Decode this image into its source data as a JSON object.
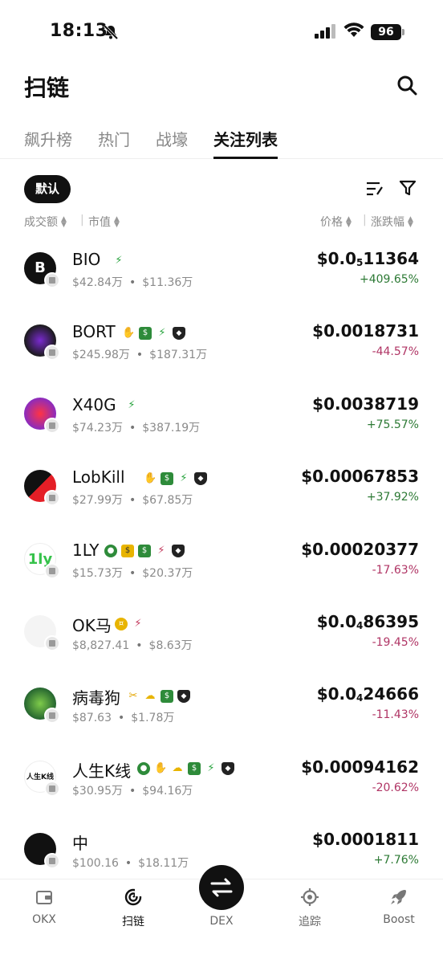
{
  "status": {
    "time": "18:13",
    "battery": "96"
  },
  "header": {
    "title": "扫链"
  },
  "tabs": [
    {
      "label": "飙升榜"
    },
    {
      "label": "热门"
    },
    {
      "label": "战壕"
    },
    {
      "label": "关注列表"
    }
  ],
  "filter": {
    "chip": "默认"
  },
  "columns": {
    "volume": "成交额",
    "mcap": "市值",
    "price": "价格",
    "change": "涨跌幅"
  },
  "tokens": [
    {
      "name": "BIO",
      "tags": [
        "bolt"
      ],
      "volume": "$42.84万",
      "mcap": "$11.36万",
      "price_prefix": "$0.0",
      "price_sub": "5",
      "price_rest": "11364",
      "change": "+409.65%",
      "dir": "up"
    },
    {
      "name": "BORT",
      "tags": [
        "hand",
        "bag",
        "bolt",
        "ghost"
      ],
      "volume": "$245.98万",
      "mcap": "$187.31万",
      "price_prefix": "$0.0018731",
      "price_sub": "",
      "price_rest": "",
      "change": "-44.57%",
      "dir": "down"
    },
    {
      "name": "X40G",
      "tags": [
        "bolt"
      ],
      "volume": "$74.23万",
      "mcap": "$387.19万",
      "price_prefix": "$0.0038719",
      "price_sub": "",
      "price_rest": "",
      "change": "+75.57%",
      "dir": "up"
    },
    {
      "name": "LobKill",
      "tags": [
        "hand",
        "bag",
        "bolt",
        "ghost"
      ],
      "volume": "$27.99万",
      "mcap": "$67.85万",
      "price_prefix": "$0.00067853",
      "price_sub": "",
      "price_rest": "",
      "change": "+37.92%",
      "dir": "up"
    },
    {
      "name": "1LY",
      "tags": [
        "gem",
        "bag2",
        "bag",
        "bolt-red",
        "ghost"
      ],
      "volume": "$15.73万",
      "mcap": "$20.37万",
      "price_prefix": "$0.00020377",
      "price_sub": "",
      "price_rest": "",
      "change": "-17.63%",
      "dir": "down"
    },
    {
      "name": "OK马",
      "tags": [
        "coin",
        "bolt-red"
      ],
      "volume": "$8,827.41",
      "mcap": "$8.63万",
      "price_prefix": "$0.0",
      "price_sub": "4",
      "price_rest": "86395",
      "change": "-19.45%",
      "dir": "down"
    },
    {
      "name": "病毒狗",
      "tags": [
        "bow",
        "chef",
        "bag",
        "ghost"
      ],
      "volume": "$87.63",
      "mcap": "$1.78万",
      "price_prefix": "$0.0",
      "price_sub": "4",
      "price_rest": "24666",
      "change": "-11.43%",
      "dir": "down"
    },
    {
      "name": "人生K线",
      "tags": [
        "gem",
        "hand",
        "chef",
        "bag",
        "bolt",
        "ghost"
      ],
      "volume": "$30.95万",
      "mcap": "$94.16万",
      "price_prefix": "$0.00094162",
      "price_sub": "",
      "price_rest": "",
      "change": "-20.62%",
      "dir": "down"
    },
    {
      "name": "中",
      "tags": [],
      "volume": "$100.16",
      "mcap": "$18.11万",
      "price_prefix": "$0.0001811",
      "price_sub": "",
      "price_rest": "",
      "change": "+7.76%",
      "dir": "up"
    }
  ],
  "nav": [
    {
      "label": "OKX",
      "icon": "wallet-icon"
    },
    {
      "label": "扫链",
      "icon": "scan-chain-icon"
    },
    {
      "label": "DEX",
      "icon": "swap-icon"
    },
    {
      "label": "追踪",
      "icon": "target-icon"
    },
    {
      "label": "Boost",
      "icon": "rocket-icon"
    }
  ],
  "colors": {
    "up": "#2d7a35",
    "down": "#b03565",
    "accent": "#111111"
  }
}
